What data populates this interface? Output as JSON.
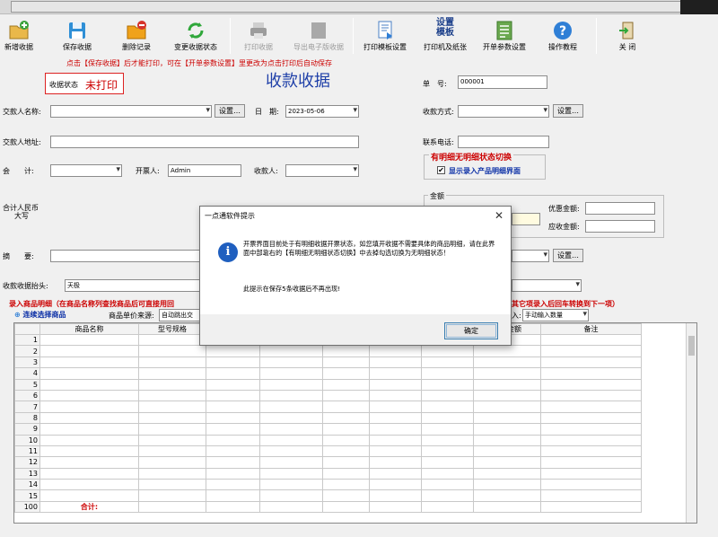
{
  "toolbar": {
    "buttons": [
      {
        "label": "新增收据",
        "icon": "folder-plus-icon",
        "disabled": false
      },
      {
        "label": "保存收据",
        "icon": "save-icon",
        "disabled": false
      },
      {
        "label": "删除记录",
        "icon": "delete-folder-icon",
        "disabled": false
      },
      {
        "label": "变更收据状态",
        "icon": "refresh-icon",
        "disabled": false
      },
      {
        "label": "打印收据",
        "icon": "printer-icon",
        "disabled": true
      },
      {
        "label": "导出电子版收据",
        "icon": "export-icon",
        "disabled": true
      },
      {
        "label": "打印模板设置",
        "icon": "template-icon",
        "disabled": false
      },
      {
        "label": "打印机及纸张",
        "top_label": "设置\n模板",
        "icon": "text-icon",
        "disabled": false
      },
      {
        "label": "开单参数设置",
        "icon": "list-icon",
        "disabled": false
      },
      {
        "label": "操作教程",
        "icon": "help-icon",
        "disabled": false
      },
      {
        "label": "关  闭",
        "icon": "exit-icon",
        "disabled": false
      }
    ],
    "top_label_lines": [
      "设置",
      "模板"
    ]
  },
  "form": {
    "hint": "点击【保存收据】后才能打印，可在【开单参数设置】里更改为点击打印后自动保存",
    "status_label": "收据状态",
    "status_value": "未打印",
    "title": "收款收据",
    "number_label": "单　号:",
    "number_value": "000001",
    "payer_name_label": "交款人名称:",
    "payer_name_value": "",
    "settings_button": "设置…",
    "date_label": "日　期:",
    "date_value": "2023-05-06",
    "pay_method_label": "收款方式:",
    "payer_address_label": "交款人地址:",
    "phone_label": "联系电话:",
    "accounting_label": "会　　计:",
    "drawer_label": "开票人:",
    "drawer_value": "Admin",
    "receiver_label": "收款人:",
    "detail_toggle_title": "有明细无明细状态切换",
    "detail_toggle_label": "显示录入产品明细界面",
    "detail_toggle_checked": true,
    "amount_group_label": "金额",
    "discount_label": "优惠金额:",
    "receivable_label": "应收金额:",
    "total_label_line1": "合计人民币",
    "total_label_line2": "大写",
    "summary_label": "摘　　要:",
    "header_label": "收款收据抬头:",
    "header_value": "天极",
    "entry_hint": "录入商品明细（在商品名称列查找商品后可直接用回",
    "entry_hint_tail": "其它项录入后回车转换到下一项）",
    "continuous_select": "连续选择商品",
    "price_source_label": "商品单价来源:",
    "price_source_value": "自动跳出交",
    "qty_mode_value": "手动输入数量",
    "qty_mode_prefix": "入:"
  },
  "grid": {
    "columns": [
      "",
      "商品名称",
      "型号规格",
      "",
      "",
      "",
      "",
      "",
      "实收金额",
      "备注"
    ],
    "row_numbers": [
      "1",
      "2",
      "3",
      "4",
      "5",
      "6",
      "7",
      "8",
      "9",
      "10",
      "11",
      "12",
      "13",
      "14",
      "15",
      "100"
    ],
    "total_label": "合计:"
  },
  "dialog": {
    "title": "一点通软件提示",
    "close": "✕",
    "message": "开票界面目前处于有明细收据开票状态，如您填开收据不需要具体的商品明细，请在此界面中部靠右的【有明细无明细状态切换】中去掉勾选切换为无明细状态！",
    "message2": "此提示在保存5条收据后不再出现!",
    "ok": "确定"
  }
}
